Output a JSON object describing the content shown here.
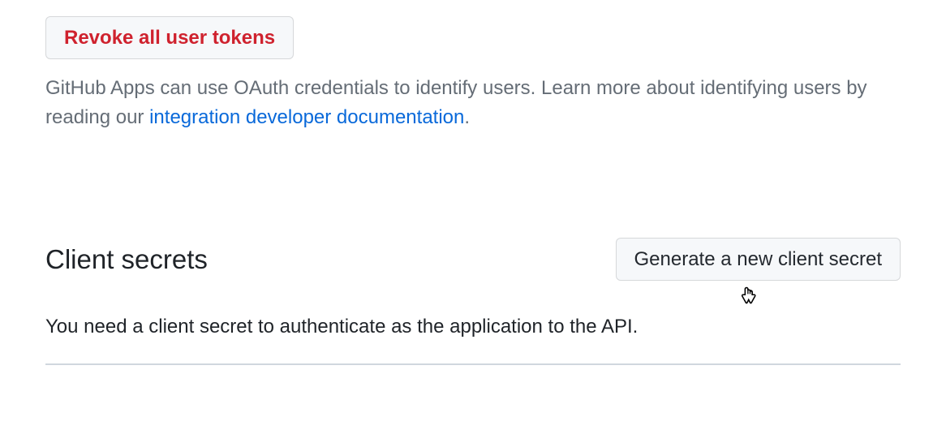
{
  "revoke": {
    "button_label": "Revoke all user tokens",
    "description_pre": "GitHub Apps can use OAuth credentials to identify users. Learn more about identifying users by reading our ",
    "link_label": "integration developer documentation",
    "description_post": "."
  },
  "client_secrets": {
    "heading": "Client secrets",
    "generate_label": "Generate a new client secret",
    "helper_text": "You need a client secret to authenticate as the application to the API."
  }
}
